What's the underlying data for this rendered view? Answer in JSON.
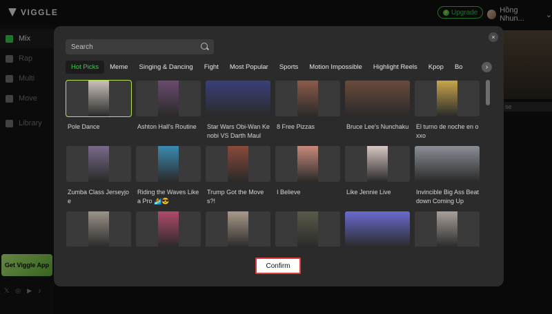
{
  "app": {
    "logo_text": "VIGGLE",
    "upgrade_label": "Upgrade",
    "user_name": "Hồng Nhun...",
    "user_chevron": "⌄"
  },
  "sidebar": {
    "items": [
      {
        "label": "Mix",
        "active": true,
        "icon": "video-icon"
      },
      {
        "label": "Rap",
        "active": false,
        "icon": "hand-icon"
      },
      {
        "label": "Multi",
        "active": false,
        "icon": "people-icon"
      },
      {
        "label": "Move",
        "active": false,
        "icon": "figure-icon"
      },
      {
        "label": "Library",
        "active": false,
        "icon": "folder-icon"
      }
    ],
    "get_app_label": "Get Viggle App",
    "socials": [
      "𝕏",
      "◎",
      "▶",
      "♪"
    ]
  },
  "background": {
    "preview_caption": "se"
  },
  "modal": {
    "close_label": "×",
    "search": {
      "placeholder": "Search",
      "value": ""
    },
    "tabs": [
      "Hot Picks",
      "Meme",
      "Singing & Dancing",
      "Fight",
      "Most Popular",
      "Sports",
      "Motion Impossible",
      "Highlight Reels",
      "Kpop",
      "Bo"
    ],
    "active_tab": "Hot Picks",
    "next_arrow": "›",
    "confirm_label": "Confirm",
    "items": [
      {
        "title": "Pole Dance",
        "selected": true,
        "color": "#c9c2b8",
        "tall": true
      },
      {
        "title": "Ashton Hall's Routine",
        "selected": false,
        "color": "#6b4a6f",
        "tall": true
      },
      {
        "title": "Star Wars Obi-Wan Kenobi VS Darth Maul",
        "selected": false,
        "color": "#3a3f7a",
        "tall": false
      },
      {
        "title": "8 Free Pizzas",
        "selected": false,
        "color": "#8c5a4a",
        "tall": true
      },
      {
        "title": "Bruce Lee's Nunchaku",
        "selected": false,
        "color": "#6a4a3a",
        "tall": false
      },
      {
        "title": "El turno de noche en oxxo",
        "selected": false,
        "color": "#c9a64a",
        "tall": true
      },
      {
        "title": "Zumba Class Jerseyjoe",
        "selected": false,
        "color": "#7a6a8a",
        "tall": true
      },
      {
        "title": "Riding the Waves Like a Pro 🏄😎",
        "selected": false,
        "color": "#3a8ab0",
        "tall": true
      },
      {
        "title": "Trump Got the Moves?!",
        "selected": false,
        "color": "#8a4a3a",
        "tall": true
      },
      {
        "title": "I Believe",
        "selected": false,
        "color": "#c88a7a",
        "tall": true
      },
      {
        "title": "Like Jennie Live",
        "selected": false,
        "color": "#d9c8c4",
        "tall": true
      },
      {
        "title": "Invincible Big Ass Beatdown Coming Up",
        "selected": false,
        "color": "#8a8f96",
        "tall": false
      },
      {
        "title": "",
        "selected": false,
        "color": "#9a9488",
        "tall": true
      },
      {
        "title": "",
        "selected": false,
        "color": "#b04a6a",
        "tall": true
      },
      {
        "title": "",
        "selected": false,
        "color": "#a89a8a",
        "tall": true
      },
      {
        "title": "",
        "selected": false,
        "color": "#5a5a4a",
        "tall": true
      },
      {
        "title": "",
        "selected": false,
        "color": "#6a6ad0",
        "tall": false
      },
      {
        "title": "",
        "selected": false,
        "color": "#a8a09a",
        "tall": true
      }
    ]
  },
  "colors": {
    "accent": "#3ccf4e",
    "confirm_border": "#e13c3c"
  }
}
